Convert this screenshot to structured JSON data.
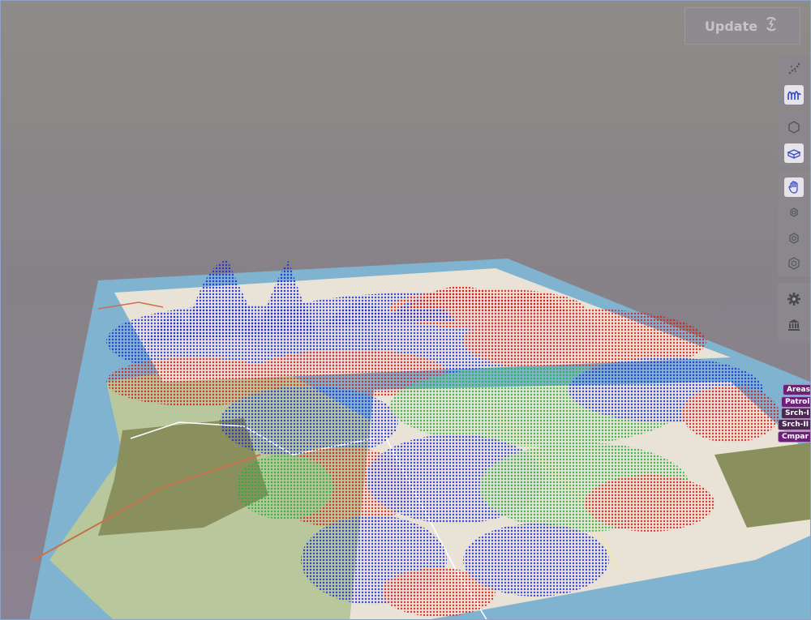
{
  "toolbar_top": {
    "update_label": "Update",
    "update_icon": "refresh-bolt-icon"
  },
  "side_toolbar": {
    "groups": [
      {
        "items": [
          {
            "icon": "scatter-points-icon",
            "active": false
          },
          {
            "icon": "surface-wave-icon",
            "active": true
          }
        ]
      },
      {
        "items": [
          {
            "icon": "hexagon-outline-icon",
            "active": false
          },
          {
            "icon": "terrain-box-icon",
            "active": true
          }
        ]
      },
      {
        "items": [
          {
            "icon": "hand-pan-icon",
            "active": true
          },
          {
            "icon": "gear-hexagon-small-icon",
            "active": false
          },
          {
            "icon": "gear-hexagon-medium-icon",
            "active": false
          },
          {
            "icon": "gear-hexagon-large-icon",
            "active": false
          }
        ]
      },
      {
        "items": [
          {
            "icon": "settings-gear-icon",
            "active": false
          },
          {
            "icon": "museum-building-icon",
            "active": false
          }
        ]
      }
    ]
  },
  "layer_tags": [
    {
      "label": "Areas",
      "active": true
    },
    {
      "label": "Patrol",
      "active": true
    },
    {
      "label": "Srch-I",
      "active": false
    },
    {
      "label": "Srch-II",
      "active": false
    },
    {
      "label": "Cmpar",
      "active": true
    }
  ],
  "colors": {
    "sky_top": "#8e8c88",
    "sky_bottom": "#8a8290",
    "water": "#7fb3cf",
    "land": "#b8c79c",
    "park": "#8a8f5e",
    "urban": "#e9e2d6",
    "series_red": "#d61a1a",
    "series_green": "#22b33a",
    "series_blue": "#1a2bd6",
    "road_major": "#c9704a"
  }
}
